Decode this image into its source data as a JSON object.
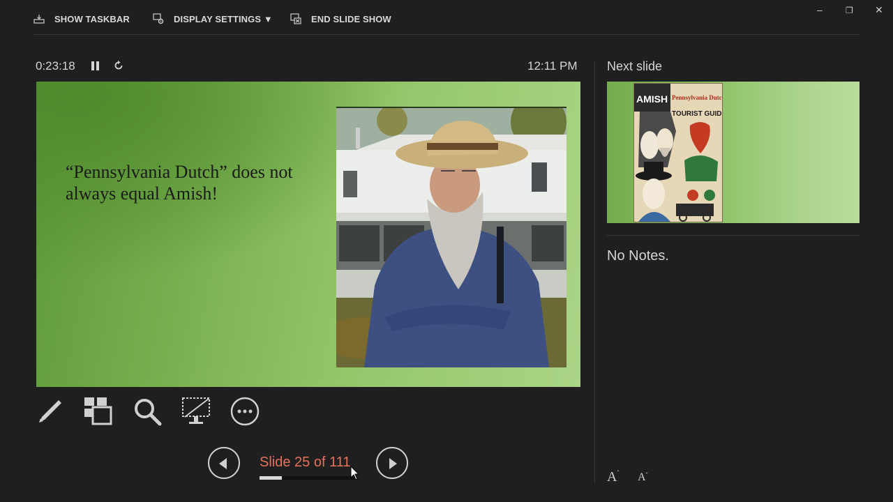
{
  "toolbar": {
    "show_taskbar": "SHOW TASKBAR",
    "display_settings": "DISPLAY SETTINGS ▼",
    "end_slide_show": "END SLIDE SHOW"
  },
  "window_controls": {
    "minimize": "–",
    "restore": "❐",
    "close": "✕"
  },
  "timer": {
    "elapsed": "0:23:18",
    "clock": "12:11 PM"
  },
  "slide": {
    "text": "“Pennsylvania Dutch” does not always equal Amish!"
  },
  "navigation": {
    "counter": "Slide 25 of 111",
    "current": 25,
    "total": 111,
    "progress_fraction": 0.225
  },
  "next_slide": {
    "label": "Next slide",
    "guide_title_1": "AMISH",
    "guide_title_2": "Pennsylvania Dutch",
    "guide_title_3": "TOURIST GUIDE"
  },
  "notes": {
    "text": "No Notes."
  },
  "font_controls": {
    "increase": "A",
    "decrease": "A"
  },
  "colors": {
    "accent": "#e8715a",
    "background": "#1f1f1f"
  }
}
